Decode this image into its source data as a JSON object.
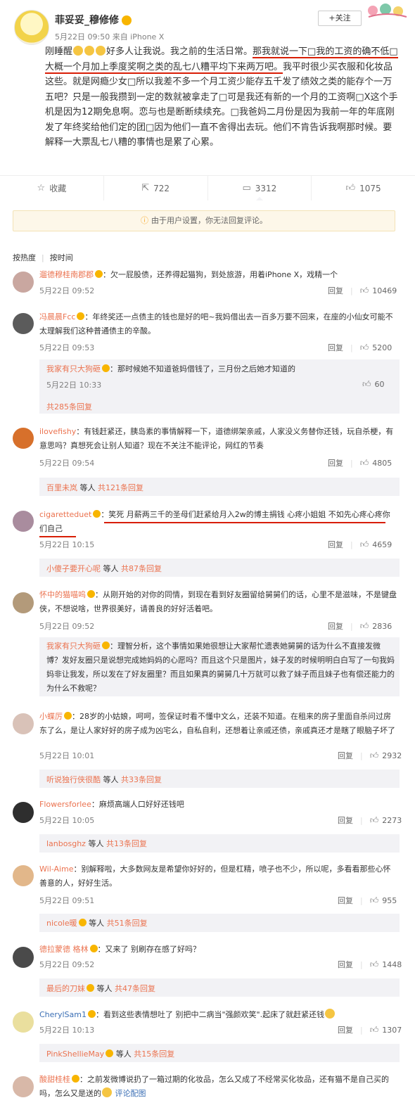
{
  "post": {
    "author": "菲妥妥_穆修修",
    "meta": "5月22日 09:50 来自 iPhone X",
    "follow_label": "+关注",
    "text_a": "刚睡醒",
    "text_b": "好多人让我说。我之前的生活日常。",
    "text_hl": "那我就说一下□我的工资的确不低□大概一个月加上季度奖啊之类的乱七八糟平均下来两万吧。",
    "text_c": "我平时很少买衣服和化妆品这些。就是网瘾少女□所以我差不多一个月工资少能存五千发了绩效之类的能存个一万五吧？只是一般我攒到一定的数就被拿走了□可是我还有新的一个月的工资啊□X这个手机是因为12期免息啊。恋与也是断断续续充。□我爸妈二月份是因为我前一年的年底刚发了年终奖给他们定的团□因为他们一直不舍得出去玩。他们不肯告诉我啊那时候。要解释一大票乱七八糟的事情也是累了心累。"
  },
  "actions": {
    "favorite": "收藏",
    "repost": "722",
    "comment": "3312",
    "like": "1075"
  },
  "notice": "由于用户设置，你无法回复评论。",
  "sort": {
    "hot": "按热度",
    "time": "按时间"
  },
  "comments": [
    {
      "user": "遛德穆桂南郡郡",
      "text": "：欠一屁股债，还养得起猫狗，到处旅游，用着iPhone X，戏精一个",
      "time": "5月22日 09:52",
      "reply": "回复",
      "likes": "10469"
    },
    {
      "user": "冯晨晨Fcc",
      "text": "：年终奖还一点债主的钱也是好的吧~我妈借出去一百多万要不回来，在座的小仙女可能不太理解我们这种普通债主的辛酸。",
      "time": "5月22日 09:53",
      "reply": "回复",
      "likes": "5200",
      "sub": {
        "user": "我家有只大狗砸",
        "text": "：那时候她不知道爸妈借钱了，三月份之后她才知道的",
        "time": "5月22日 10:33",
        "likes": "60",
        "more": "共285条回复"
      }
    },
    {
      "user": "ilovefishy",
      "text": "：有钱赶紧还，胰岛素的事情解释一下，道德绑架亲戚，人家没义务替你还钱，玩自杀梗，有意思吗？真想死会让别人知道？现在不关注不能评论，网红的节奏",
      "time": "5月22日 09:54",
      "reply": "回复",
      "likes": "4805",
      "more_user": "百里未岚",
      "more_mid": " 等人 ",
      "more_count": "共121条回复"
    },
    {
      "user": "cigaretteduet",
      "text": "：笑死 月薪两三千的圣母们赶紧给月入2w的博主捐钱 心疼小姐姐 不如先心疼心疼你们自己",
      "time": "5月22日 10:15",
      "reply": "回复",
      "likes": "4659",
      "more_user": "小傻子要开心呢",
      "more_mid": " 等人 ",
      "more_count": "共87条回复"
    },
    {
      "user": "怀中的猫喵呜",
      "text": "：从刚开始的对你的同情，到现在看到好友圈留给舅舅们的话，心里不是滋味，不是键盘侠，不想说啥，世界很美好，请善良的好好活着吧。",
      "time": "5月22日 09:52",
      "reply": "回复",
      "likes": "2836",
      "sub": {
        "user": "我家有只大狗砸",
        "text": "：理智分析，这个事情如果她很想让大家帮忙遗表她舅舅的话为什么不直接发微博？发好友圈只是说想完成她妈妈的心愿吗？而且这个只是图片，妹子发的时候明明白白写了一句我妈妈非让我发，所以发在了好友圈里？而且如果真的舅舅几十万就可以救了妹子而且妹子也有偿还能力的为什么不救呢？"
      }
    },
    {
      "user": "小蝶厉",
      "text": "：28岁的小姑娘，呵呵，签保证时看不懂中文么，还装不知道。在租来的房子里面自杀问过房东了么，是让人家好好的房子成为凶宅么，自私自利，还想着让亲戚还债，亲戚真还才是瞎了眼脑子坏了",
      "time": "5月22日 10:01",
      "reply": "回复",
      "likes": "2932",
      "more_user": "听说独行侠很酷",
      "more_mid": " 等人 ",
      "more_count": "共33条回复"
    },
    {
      "user": "Flowersforlee",
      "text": "：麻烦高端人口好好还钱吧",
      "time": "5月22日 10:05",
      "reply": "回复",
      "likes": "2273",
      "more_user": "lanbosghz",
      "more_mid": " 等人 ",
      "more_count": "共13条回复"
    },
    {
      "user": "Wil-Aime",
      "text": "：别解释啦，大多数网友是希望你好好的，但是杠精，喷子也不少，所以呢，多看看那些心怀善意的人，好好生活。",
      "time": "5月22日 09:51",
      "reply": "回复",
      "likes": "955",
      "more_user": "nicole暖",
      "more_mid": " 等人 ",
      "more_count": "共51条回复"
    },
    {
      "user": "德拉蒙德 格林",
      "text": "：又来了 别刷存在感了好吗？",
      "time": "5月22日 09:52",
      "reply": "回复",
      "likes": "1448",
      "more_user": "最后的刀妹",
      "more_mid": " 等人 ",
      "more_count": "共47条回复"
    },
    {
      "user": "CherylSam1",
      "text": "：看到这些表情想吐了 别把中二病当\"强颜欢笑\".起床了就赶紧还钱",
      "time": "5月22日 10:13",
      "reply": "回复",
      "likes": "1307",
      "more_user": "PinkShellieMay",
      "more_mid": " 等人 ",
      "more_count": "共15条回复"
    },
    {
      "user": "酸甜桂桂",
      "text": "：之前发微博说扔了一箱过期的化妆品，怎么又成了不经常买化妆品，还有猫不是自己买的吗，怎么又是送的",
      "tail": "评论配图"
    }
  ],
  "colors": {
    "accent": "#eb7350",
    "underline": "#d81e06",
    "link": "#3b6fb5"
  }
}
